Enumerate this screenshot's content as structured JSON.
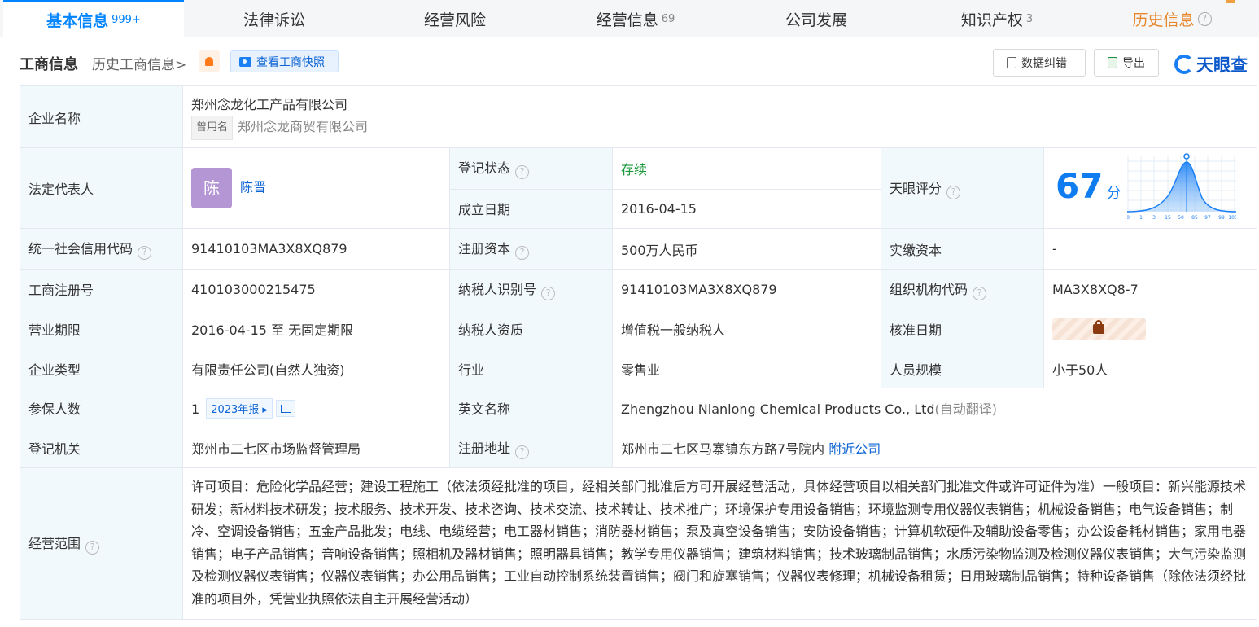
{
  "tabs": [
    {
      "label": "基本信息",
      "count": "999+"
    },
    {
      "label": "法律诉讼",
      "count": ""
    },
    {
      "label": "经营风险",
      "count": ""
    },
    {
      "label": "经营信息",
      "count": "69"
    },
    {
      "label": "公司发展",
      "count": ""
    },
    {
      "label": "知识产权",
      "count": "3"
    },
    {
      "label": "历史信息",
      "count": ""
    }
  ],
  "section": {
    "title": "工商信息",
    "history_link": "历史工商信息",
    "history_arrow": ">",
    "snapshot_button": "查看工商快照",
    "correct_button": "数据纠错",
    "export_button": "导出",
    "brand": "天眼查"
  },
  "company": {
    "name": "郑州念龙化工产品有限公司",
    "former_tag": "曾用名",
    "former_name": "郑州念龙商贸有限公司"
  },
  "labels": {
    "company_name": "企业名称",
    "legal_rep": "法定代表人",
    "reg_status": "登记状态",
    "found_date": "成立日期",
    "score": "天眼评分",
    "credit_code": "统一社会信用代码",
    "reg_capital": "注册资本",
    "paid_capital": "实缴资本",
    "reg_no": "工商注册号",
    "taxpayer_id": "纳税人识别号",
    "org_code": "组织机构代码",
    "biz_term": "营业期限",
    "taxpayer_qual": "纳税人资质",
    "approve_date": "核准日期",
    "company_type": "企业类型",
    "industry": "行业",
    "staff_size": "人员规模",
    "insured": "参保人数",
    "english_name": "英文名称",
    "reg_authority": "登记机关",
    "reg_address": "注册地址",
    "biz_scope": "经营范围"
  },
  "values": {
    "avatar_char": "陈",
    "legal_rep": "陈晋",
    "reg_status": "存续",
    "found_date": "2016-04-15",
    "score": "67",
    "score_unit": "分",
    "credit_code": "91410103MA3X8XQ879",
    "reg_capital": "500万人民币",
    "paid_capital": "-",
    "reg_no": "410103000215475",
    "taxpayer_id": "91410103MA3X8XQ879",
    "org_code": "MA3X8XQ8-7",
    "biz_term": "2016-04-15 至 无固定期限",
    "taxpayer_qual": "增值税一般纳税人",
    "company_type": "有限责任公司(自然人独资)",
    "industry": "零售业",
    "staff_size": "小于50人",
    "insured_count": "1",
    "insured_year": "2023年报",
    "english_name": "Zhengzhou Nianlong Chemical Products Co., Ltd",
    "english_note": "(自动翻译)",
    "reg_authority": "郑州市二七区市场监督管理局",
    "reg_address": "郑州市二七区马寨镇东方路7号院内",
    "nearby_link": "附近公司",
    "biz_scope": "许可项目：危险化学品经营；建设工程施工（依法须经批准的项目，经相关部门批准后方可开展经营活动，具体经营项目以相关部门批准文件或许可证件为准）一般项目：新兴能源技术研发；新材料技术研发；技术服务、技术开发、技术咨询、技术交流、技术转让、技术推广；环境保护专用设备销售；环境监测专用仪器仪表销售；机械设备销售；电气设备销售；制冷、空调设备销售；五金产品批发；电线、电缆经营；电工器材销售；消防器材销售；泵及真空设备销售；安防设备销售；计算机软硬件及辅助设备零售；办公设备耗材销售；家用电器销售；电子产品销售；音响设备销售；照相机及器材销售；照明器具销售；教学专用仪器销售；建筑材料销售；技术玻璃制品销售；水质污染物监测及检测仪器仪表销售；大气污染监测及检测仪器仪表销售；仪器仪表销售；办公用品销售；工业自动控制系统装置销售；阀门和旋塞销售；仪器仪表修理；机械设备租赁；日用玻璃制品销售；特种设备销售（除依法须经批准的项目外，凭营业执照依法自主开展经营活动）"
  },
  "score_chart": {
    "ticks": [
      "0",
      "1",
      "3",
      "15",
      "50",
      "85",
      "97",
      "99",
      "100"
    ],
    "marker_tick": "50"
  }
}
